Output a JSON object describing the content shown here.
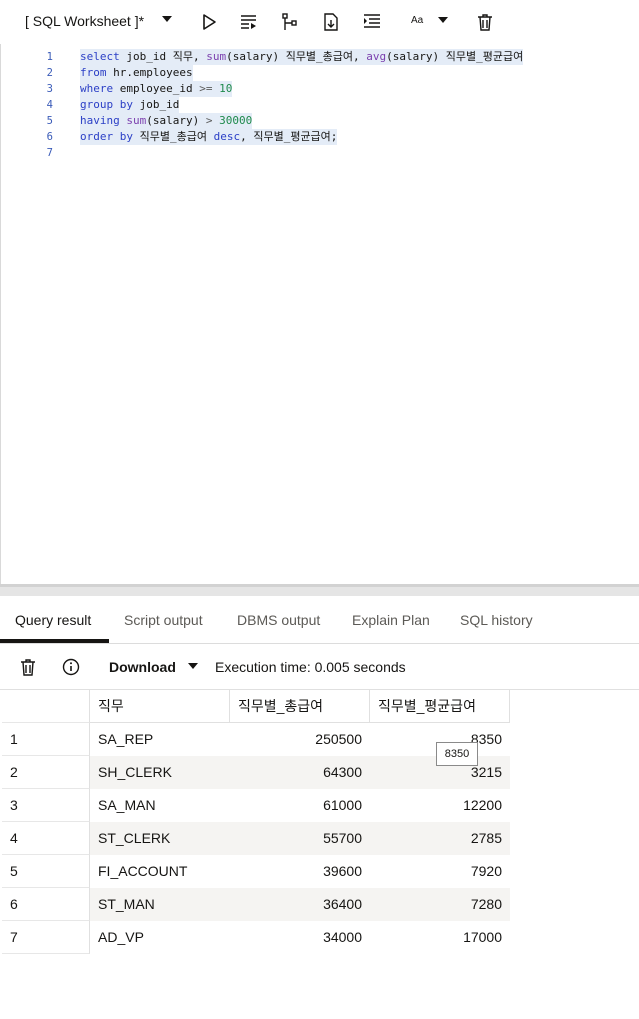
{
  "toolbar": {
    "title": "[ SQL Worksheet ]*",
    "font_size_label": "Aa"
  },
  "editor": {
    "lines": [
      {
        "num": "1",
        "tokens": [
          {
            "t": "select",
            "c": "kw"
          },
          {
            "t": " job_id 직무, ",
            "c": "txt"
          },
          {
            "t": "sum",
            "c": "fn"
          },
          {
            "t": "(salary) 직무별_총급여, ",
            "c": "txt"
          },
          {
            "t": "avg",
            "c": "fn"
          },
          {
            "t": "(salary) 직무별_평균급여",
            "c": "txt"
          }
        ]
      },
      {
        "num": "2",
        "tokens": [
          {
            "t": "from",
            "c": "kw"
          },
          {
            "t": " hr.employees",
            "c": "txt"
          }
        ]
      },
      {
        "num": "3",
        "tokens": [
          {
            "t": "where",
            "c": "kw"
          },
          {
            "t": " employee_id ",
            "c": "txt"
          },
          {
            "t": ">=",
            "c": "op"
          },
          {
            "t": " ",
            "c": "txt"
          },
          {
            "t": "10",
            "c": "num"
          }
        ]
      },
      {
        "num": "4",
        "tokens": [
          {
            "t": "group",
            "c": "kw"
          },
          {
            "t": " ",
            "c": "txt"
          },
          {
            "t": "by",
            "c": "kw"
          },
          {
            "t": " job_id",
            "c": "txt"
          }
        ]
      },
      {
        "num": "5",
        "tokens": [
          {
            "t": "having",
            "c": "kw"
          },
          {
            "t": " ",
            "c": "txt"
          },
          {
            "t": "sum",
            "c": "fn"
          },
          {
            "t": "(salary) ",
            "c": "txt"
          },
          {
            "t": ">",
            "c": "op"
          },
          {
            "t": " ",
            "c": "txt"
          },
          {
            "t": "30000",
            "c": "num"
          }
        ]
      },
      {
        "num": "6",
        "tokens": [
          {
            "t": "order",
            "c": "kw"
          },
          {
            "t": " ",
            "c": "txt"
          },
          {
            "t": "by",
            "c": "kw"
          },
          {
            "t": " 직무별_총급여 ",
            "c": "txt"
          },
          {
            "t": "desc",
            "c": "kw"
          },
          {
            "t": ", 직무별_평균급여;",
            "c": "txt"
          }
        ]
      },
      {
        "num": "7",
        "tokens": []
      }
    ]
  },
  "tabs": [
    {
      "label": "Query result",
      "active": true
    },
    {
      "label": "Script output",
      "active": false
    },
    {
      "label": "DBMS output",
      "active": false
    },
    {
      "label": "Explain Plan",
      "active": false
    },
    {
      "label": "SQL history",
      "active": false
    }
  ],
  "results_toolbar": {
    "download_label": "Download",
    "execution_time": "Execution time: 0.005 seconds"
  },
  "grid": {
    "headers": [
      "직무",
      "직무별_총급여",
      "직무별_평균급여"
    ],
    "rows": [
      {
        "rn": "1",
        "job": "SA_REP",
        "total": "250500",
        "avg": "8350"
      },
      {
        "rn": "2",
        "job": "SH_CLERK",
        "total": "64300",
        "avg": "3215"
      },
      {
        "rn": "3",
        "job": "SA_MAN",
        "total": "61000",
        "avg": "12200"
      },
      {
        "rn": "4",
        "job": "ST_CLERK",
        "total": "55700",
        "avg": "2785"
      },
      {
        "rn": "5",
        "job": "FI_ACCOUNT",
        "total": "39600",
        "avg": "7920"
      },
      {
        "rn": "6",
        "job": "ST_MAN",
        "total": "36400",
        "avg": "7280"
      },
      {
        "rn": "7",
        "job": "AD_VP",
        "total": "34000",
        "avg": "17000"
      }
    ]
  },
  "tooltip": {
    "text": "8350"
  }
}
